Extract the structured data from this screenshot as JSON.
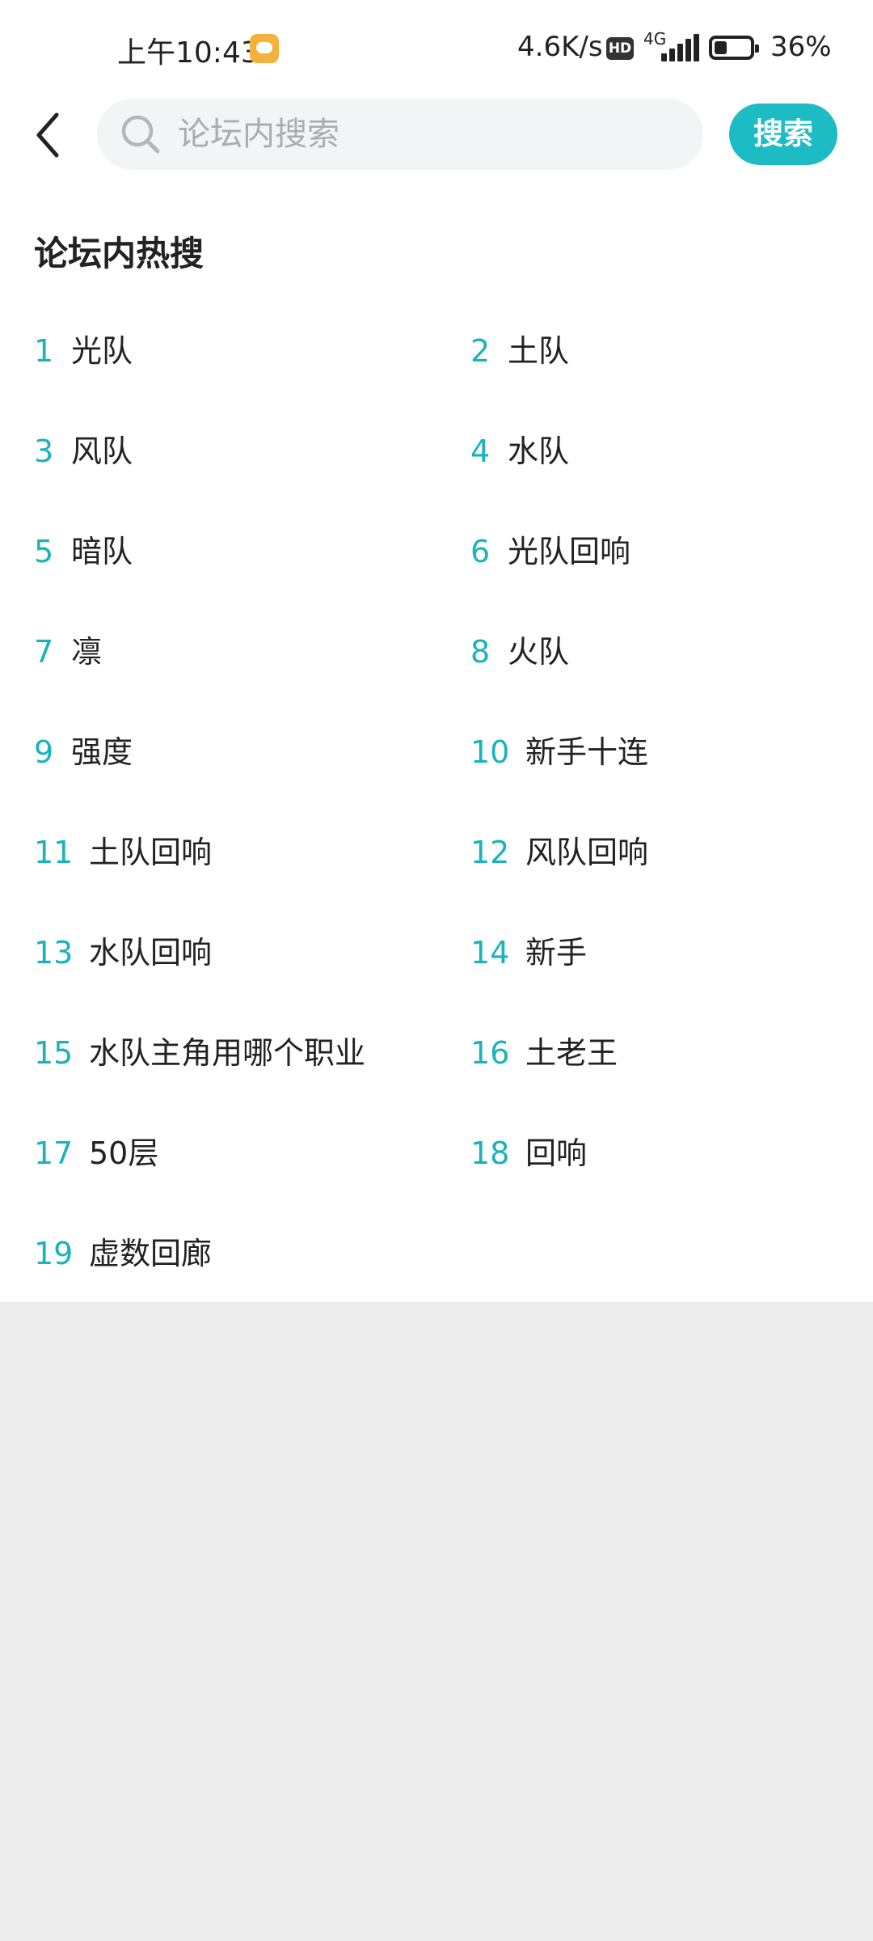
{
  "status_bar": {
    "time": "上午10:43",
    "network_speed": "4.6K/s",
    "hd_badge": "HD",
    "network_type": "4G",
    "battery_percent": "36%",
    "battery_level": 0.36
  },
  "header": {
    "back_icon": "chevron-left-icon",
    "search_icon": "search-icon",
    "search_placeholder": "论坛内搜索",
    "search_value": "",
    "search_button_label": "搜索"
  },
  "hot_section": {
    "title": "论坛内热搜",
    "items": [
      {
        "rank": "1",
        "text": "光队"
      },
      {
        "rank": "2",
        "text": "土队"
      },
      {
        "rank": "3",
        "text": "风队"
      },
      {
        "rank": "4",
        "text": "水队"
      },
      {
        "rank": "5",
        "text": "暗队"
      },
      {
        "rank": "6",
        "text": "光队回响"
      },
      {
        "rank": "7",
        "text": "凛"
      },
      {
        "rank": "8",
        "text": "火队"
      },
      {
        "rank": "9",
        "text": "强度"
      },
      {
        "rank": "10",
        "text": "新手十连"
      },
      {
        "rank": "11",
        "text": "土队回响"
      },
      {
        "rank": "12",
        "text": "风队回响"
      },
      {
        "rank": "13",
        "text": "水队回响"
      },
      {
        "rank": "14",
        "text": "新手"
      },
      {
        "rank": "15",
        "text": "水队主角用哪个职业"
      },
      {
        "rank": "16",
        "text": "土老王"
      },
      {
        "rank": "17",
        "text": "50层"
      },
      {
        "rank": "18",
        "text": "回响"
      },
      {
        "rank": "19",
        "text": "虚数回廊"
      }
    ]
  },
  "colors": {
    "accent": "#1dbcc5",
    "rank_number": "#1ab3bc",
    "background": "#ededed",
    "panel": "#ffffff"
  }
}
